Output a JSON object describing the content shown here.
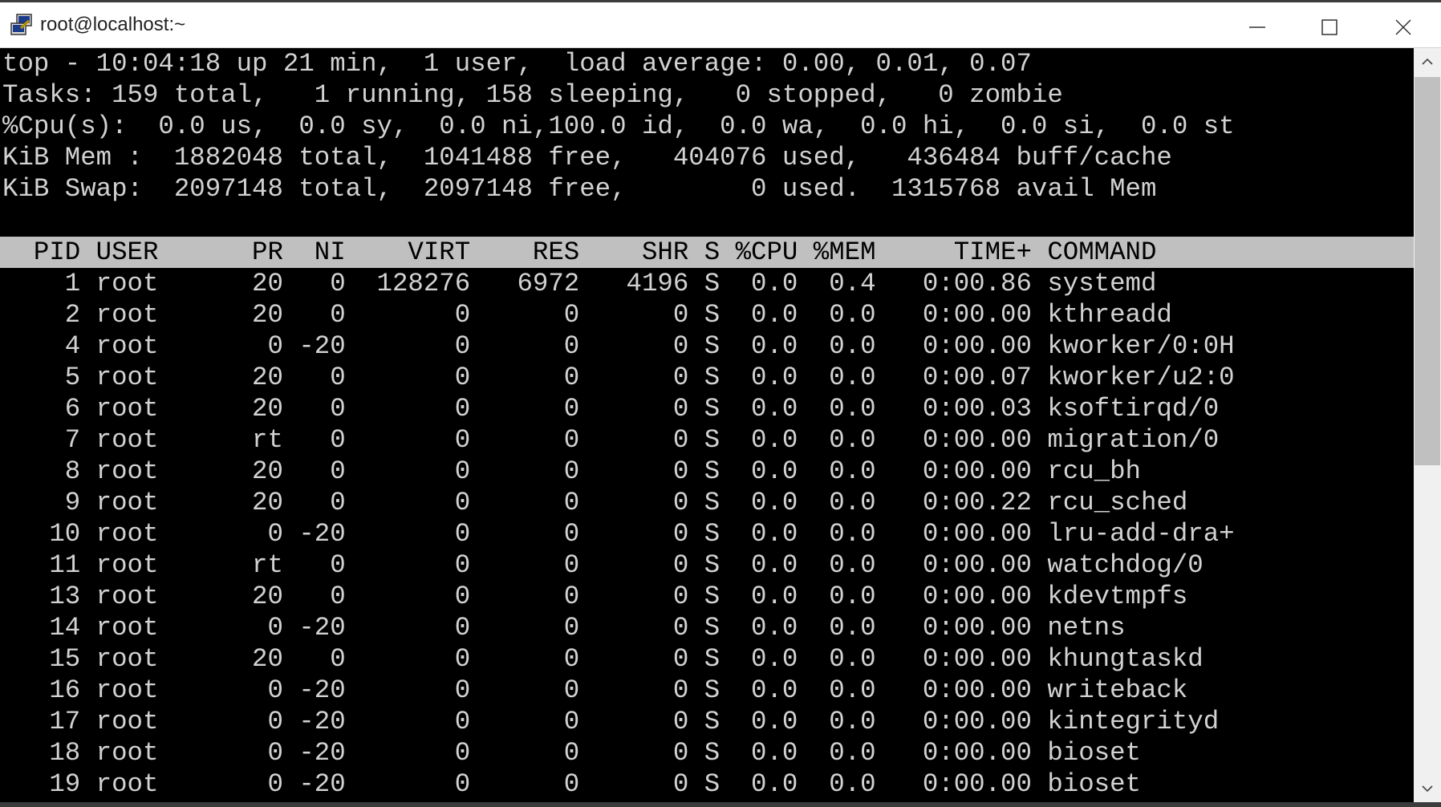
{
  "window": {
    "title": "root@localhost:~",
    "icons": {
      "app": "putty-terminal-icon",
      "minimize": "minimize-icon",
      "maximize": "maximize-icon",
      "close": "close-icon",
      "scroll_up": "chevron-up-icon",
      "scroll_down": "chevron-down-icon"
    }
  },
  "colors": {
    "terminal_bg": "#000000",
    "terminal_fg": "#d2d2d2",
    "header_bar_bg": "#c0c0c0",
    "header_text": "#000000"
  },
  "summary": [
    "top - 10:04:18 up 21 min,  1 user,  load average: 0.00, 0.01, 0.07",
    "Tasks: 159 total,   1 running, 158 sleeping,   0 stopped,   0 zombie",
    "%Cpu(s):  0.0 us,  0.0 sy,  0.0 ni,100.0 id,  0.0 wa,  0.0 hi,  0.0 si,  0.0 st",
    "KiB Mem :  1882048 total,  1041488 free,   404076 used,   436484 buff/cache",
    "KiB Swap:  2097148 total,  2097148 free,        0 used.  1315768 avail Mem"
  ],
  "table": {
    "header": "  PID USER      PR  NI    VIRT    RES    SHR S %CPU %MEM     TIME+ COMMAND",
    "rows": [
      "    1 root      20   0  128276   6972   4196 S  0.0  0.4   0:00.86 systemd",
      "    2 root      20   0       0      0      0 S  0.0  0.0   0:00.00 kthreadd",
      "    4 root       0 -20       0      0      0 S  0.0  0.0   0:00.00 kworker/0:0H",
      "    5 root      20   0       0      0      0 S  0.0  0.0   0:00.07 kworker/u2:0",
      "    6 root      20   0       0      0      0 S  0.0  0.0   0:00.03 ksoftirqd/0",
      "    7 root      rt   0       0      0      0 S  0.0  0.0   0:00.00 migration/0",
      "    8 root      20   0       0      0      0 S  0.0  0.0   0:00.00 rcu_bh",
      "    9 root      20   0       0      0      0 S  0.0  0.0   0:00.22 rcu_sched",
      "   10 root       0 -20       0      0      0 S  0.0  0.0   0:00.00 lru-add-dra+",
      "   11 root      rt   0       0      0      0 S  0.0  0.0   0:00.00 watchdog/0",
      "   13 root      20   0       0      0      0 S  0.0  0.0   0:00.00 kdevtmpfs",
      "   14 root       0 -20       0      0      0 S  0.0  0.0   0:00.00 netns",
      "   15 root      20   0       0      0      0 S  0.0  0.0   0:00.00 khungtaskd",
      "   16 root       0 -20       0      0      0 S  0.0  0.0   0:00.00 writeback",
      "   17 root       0 -20       0      0      0 S  0.0  0.0   0:00.00 kintegrityd",
      "   18 root       0 -20       0      0      0 S  0.0  0.0   0:00.00 bioset",
      "   19 root       0 -20       0      0      0 S  0.0  0.0   0:00.00 bioset"
    ]
  }
}
